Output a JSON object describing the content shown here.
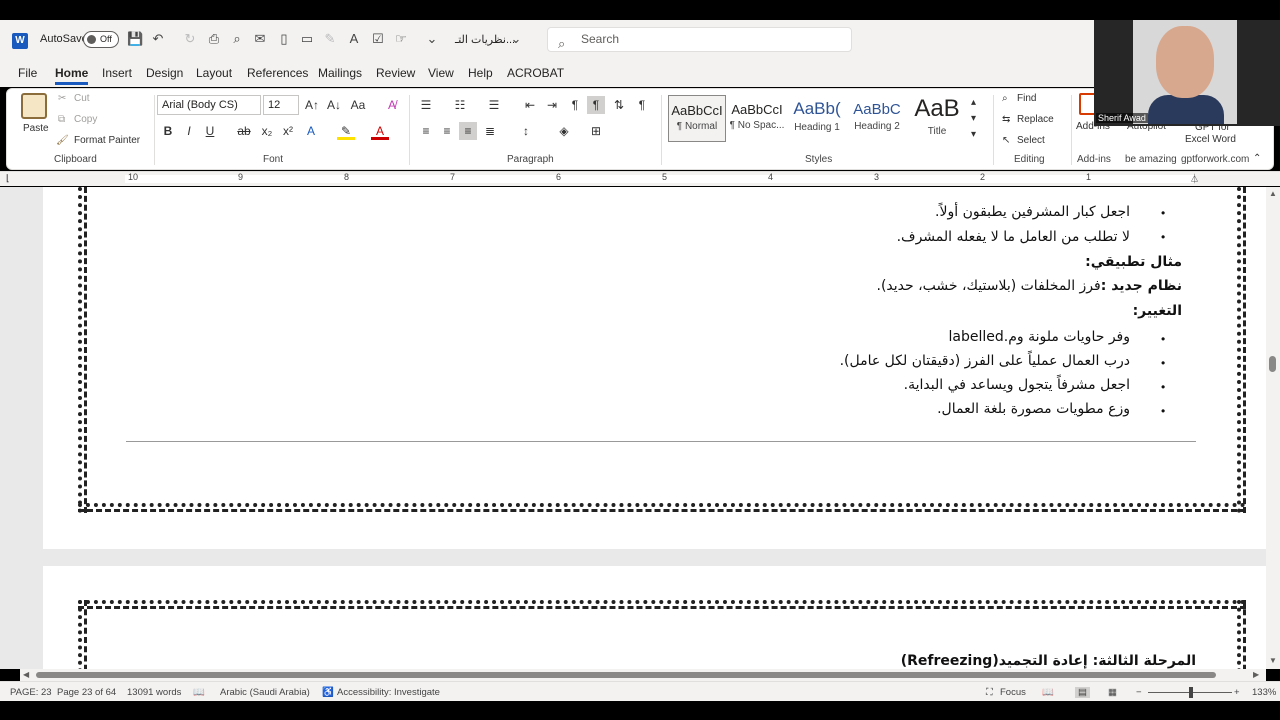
{
  "app": {
    "logo_letter": "W",
    "autosave_label": "AutoSave",
    "autosave_state": "Off",
    "doc_title": "نظريات التـ...",
    "search_placeholder": "Search"
  },
  "menu": [
    "File",
    "Home",
    "Insert",
    "Design",
    "Layout",
    "References",
    "Mailings",
    "Review",
    "View",
    "Help",
    "ACROBAT"
  ],
  "ribbon": {
    "clipboard": {
      "paste": "Paste",
      "cut": "Cut",
      "copy": "Copy",
      "format_painter": "Format Painter",
      "group": "Clipboard"
    },
    "font": {
      "name": "Arial (Body CS)",
      "size": "12",
      "group": "Font"
    },
    "paragraph": {
      "group": "Paragraph"
    },
    "styles": {
      "items": [
        {
          "preview": "AaBbCcI",
          "name": "¶ Normal"
        },
        {
          "preview": "AaBbCcI",
          "name": "¶ No Spac..."
        },
        {
          "preview": "AaBb(",
          "name": "Heading 1"
        },
        {
          "preview": "AaBbC",
          "name": "Heading 2"
        },
        {
          "preview": "AaB",
          "name": "Title"
        }
      ],
      "group": "Styles"
    },
    "editing": {
      "find": "Find",
      "replace": "Replace",
      "select": "Select",
      "group": "Editing"
    },
    "addins": {
      "addins": "Add-ins",
      "group": "Add-ins",
      "autopilot": "Autopilot",
      "be_amazing": "be amazing",
      "gpt_line1": "GPT for",
      "gpt_line2": "Excel Word",
      "gpt_site": "gptforwork.com"
    }
  },
  "ruler": [
    "10",
    "9",
    "8",
    "7",
    "6",
    "5",
    "4",
    "3",
    "2",
    "1"
  ],
  "document": {
    "page1_lines": [
      {
        "kind": "bullet",
        "text": "اجعل كبار المشرفين يطبقون أولاً."
      },
      {
        "kind": "bullet",
        "text": "لا تطلب من العامل ما لا يفعله المشرف."
      },
      {
        "kind": "heading",
        "text": "مثال تطبيقي:"
      },
      {
        "kind": "mixed",
        "bold": "نظام جديد :",
        "text": "فرز المخلفات (بلاستيك، خشب، حديد)."
      },
      {
        "kind": "heading",
        "text": "التغيير:"
      },
      {
        "kind": "bullet",
        "text": "وفر حاويات ملونة وم.labelled"
      },
      {
        "kind": "bullet",
        "text": "درب العمال عملياً على الفرز (دقيقتان لكل عامل)."
      },
      {
        "kind": "bullet",
        "text": "اجعل مشرفاً يتجول ويساعد في البداية."
      },
      {
        "kind": "bullet",
        "text": "وزع مطويات مصورة بلغة العمال."
      }
    ],
    "page2_heading": "المرحلة الثالثة: إعادة التجميد(Refreezing)"
  },
  "status": {
    "page": "PAGE: 23",
    "page_of": "Page 23 of 64",
    "words": "13091 words",
    "language": "Arabic (Saudi Arabia)",
    "accessibility": "Accessibility: Investigate",
    "focus": "Focus",
    "zoom": "133%"
  },
  "webcam": {
    "name": "Sherif Awad"
  },
  "colors": {
    "accent": "#185abd",
    "ribbon_bg": "#f3f2f1"
  }
}
